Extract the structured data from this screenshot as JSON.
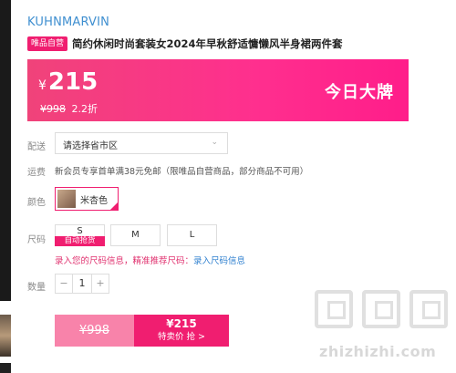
{
  "brand": "KUHNMARVIN",
  "title": {
    "badge": "唯品自营",
    "text": "简约休闲时尚套装女2024年早秋舒适慵懒风半身裙两件套"
  },
  "price": {
    "currency": "¥",
    "value": "215",
    "original": "¥998",
    "discount": "2.2折",
    "promo": "今日大牌"
  },
  "delivery": {
    "label": "配送",
    "placeholder": "请选择省市区",
    "chevron_icon": "chevron-down-icon"
  },
  "freight": {
    "label": "运费",
    "text": "新会员专享首单满38元免邮（限唯品自营商品，部分商品不可用）"
  },
  "color": {
    "label": "颜色",
    "options": [
      {
        "name": "米杏色",
        "selected": true
      }
    ]
  },
  "size": {
    "label": "尺码",
    "options": [
      {
        "name": "S",
        "badge": "自动抢货"
      },
      {
        "name": "M"
      },
      {
        "name": "L"
      }
    ],
    "info_text": "录入您的尺码信息，精准推荐尺码：",
    "info_link": "录入尺码信息"
  },
  "quantity": {
    "label": "数量",
    "minus": "−",
    "value": "1",
    "plus": "+"
  },
  "buy": {
    "original_price": "¥998",
    "sale_price": "¥215",
    "sale_label": "特卖价 抢 >"
  },
  "watermark": "zhizhizhi.com",
  "colors": {
    "accent": "#f01e70",
    "banner_start": "#f0437a",
    "banner_end": "#ff1d8a",
    "link": "#2e7fcf",
    "brand": "#3f8fd0"
  }
}
